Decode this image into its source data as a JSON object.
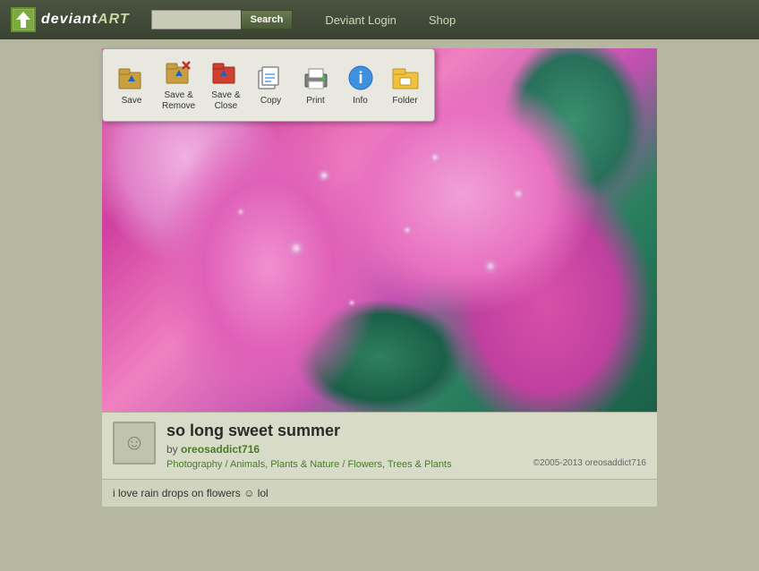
{
  "header": {
    "logo_text_plain": "deviant",
    "logo_text_italic": "ART",
    "search_placeholder": "",
    "search_button_label": "Search",
    "nav_items": [
      {
        "label": "Deviant Login",
        "id": "deviant-login"
      },
      {
        "label": "Shop",
        "id": "shop"
      }
    ]
  },
  "toolbar": {
    "items": [
      {
        "id": "save",
        "label": "Save"
      },
      {
        "id": "save-remove",
        "label1": "Save &",
        "label2": "Remove"
      },
      {
        "id": "save-close",
        "label1": "Save &",
        "label2": "Close"
      },
      {
        "id": "copy",
        "label": "Copy"
      },
      {
        "id": "print",
        "label": "Print"
      },
      {
        "id": "info",
        "label": "Info"
      },
      {
        "id": "folder",
        "label": "Folder"
      }
    ]
  },
  "image": {
    "alt": "so long sweet summer - pink flower with water drops"
  },
  "artwork": {
    "title": "so long sweet summer",
    "by_text": "by",
    "author": "oreosaddict716",
    "category": "Photography",
    "breadcrumb_sep": " / ",
    "cat2": "Animals, Plants & Nature",
    "cat3": "Flowers, Trees & Plants",
    "copyright": "©2005-2013 oreosaddict716"
  },
  "comment": {
    "text": "i love rain drops on flowers",
    "emoji": "☺",
    "suffix": " lol"
  }
}
